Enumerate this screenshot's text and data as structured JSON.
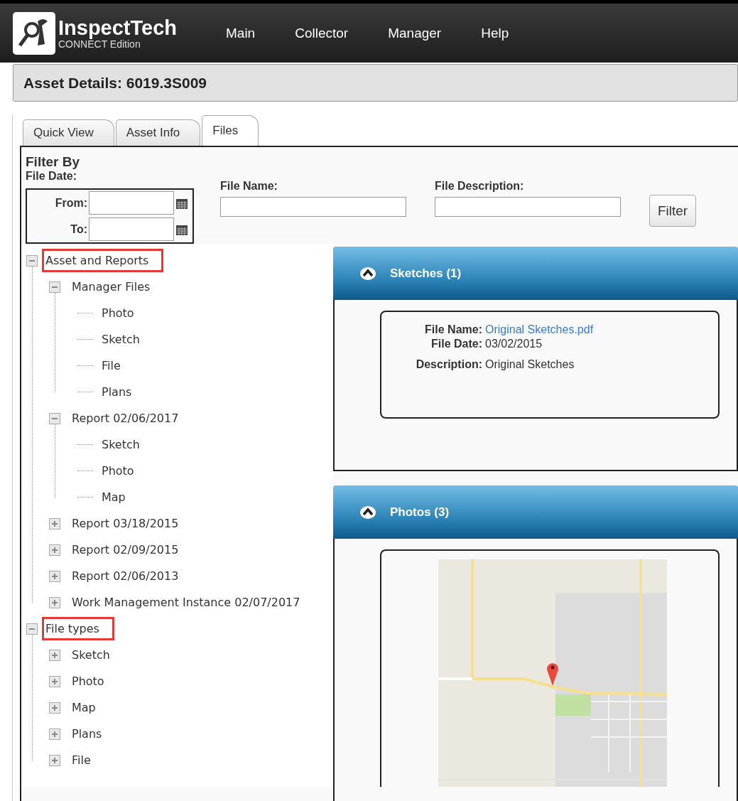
{
  "header": {
    "logo_title": "InspectTech",
    "logo_subtitle": "CONNECT Edition",
    "nav": [
      "Main",
      "Collector",
      "Manager",
      "Help"
    ]
  },
  "page_title": "Asset Details: 6019.3S009",
  "tabs": [
    {
      "label": "Quick View",
      "selected": false
    },
    {
      "label": "Asset Info",
      "selected": false
    },
    {
      "label": "Files",
      "selected": true
    }
  ],
  "filter": {
    "title": "Filter By",
    "date_label": "File Date:",
    "from_label": "From:",
    "to_label": "To:",
    "name_label": "File Name:",
    "description_label": "File Description:",
    "button": "Filter"
  },
  "tree": [
    {
      "label": "Asset and Reports",
      "kind": "group",
      "expanded": true,
      "highlighted": true,
      "children": [
        {
          "label": "Manager Files",
          "kind": "group",
          "expanded": true,
          "highlighted": false,
          "children": [
            {
              "label": "Photo",
              "kind": "leaf"
            },
            {
              "label": "Sketch",
              "kind": "leaf"
            },
            {
              "label": "File",
              "kind": "leaf"
            },
            {
              "label": "Plans",
              "kind": "leaf"
            }
          ]
        },
        {
          "label": "Report 02/06/2017",
          "kind": "group",
          "expanded": true,
          "highlighted": false,
          "children": [
            {
              "label": "Sketch",
              "kind": "leaf"
            },
            {
              "label": "Photo",
              "kind": "leaf"
            },
            {
              "label": "Map",
              "kind": "leaf"
            }
          ]
        },
        {
          "label": "Report 03/18/2015",
          "kind": "group",
          "expanded": false,
          "highlighted": false
        },
        {
          "label": "Report 02/09/2015",
          "kind": "group",
          "expanded": false,
          "highlighted": false
        },
        {
          "label": "Report 02/06/2013",
          "kind": "group",
          "expanded": false,
          "highlighted": false
        },
        {
          "label": "Work Management Instance 02/07/2017",
          "kind": "group",
          "expanded": false,
          "highlighted": false
        }
      ]
    },
    {
      "label": "File types",
      "kind": "group",
      "expanded": true,
      "highlighted": true,
      "children": [
        {
          "label": "Sketch",
          "kind": "group",
          "expanded": false,
          "highlighted": false
        },
        {
          "label": "Photo",
          "kind": "group",
          "expanded": false,
          "highlighted": false
        },
        {
          "label": "Map",
          "kind": "group",
          "expanded": false,
          "highlighted": false
        },
        {
          "label": "Plans",
          "kind": "group",
          "expanded": false,
          "highlighted": false
        },
        {
          "label": "File",
          "kind": "group",
          "expanded": false,
          "highlighted": false
        }
      ]
    }
  ],
  "panels": [
    {
      "title": "Sketches (1)",
      "expanded": true,
      "files": [
        {
          "kind": "details",
          "fields": [
            {
              "label": "File Name:",
              "value": "Original Sketches.pdf",
              "link": true
            },
            {
              "label": "File Date:",
              "value": "03/02/2015",
              "link": false
            },
            {
              "label": "Description:",
              "value": "Original Sketches",
              "link": false
            }
          ]
        }
      ]
    },
    {
      "title": "Photos (3)",
      "expanded": true
    }
  ]
}
